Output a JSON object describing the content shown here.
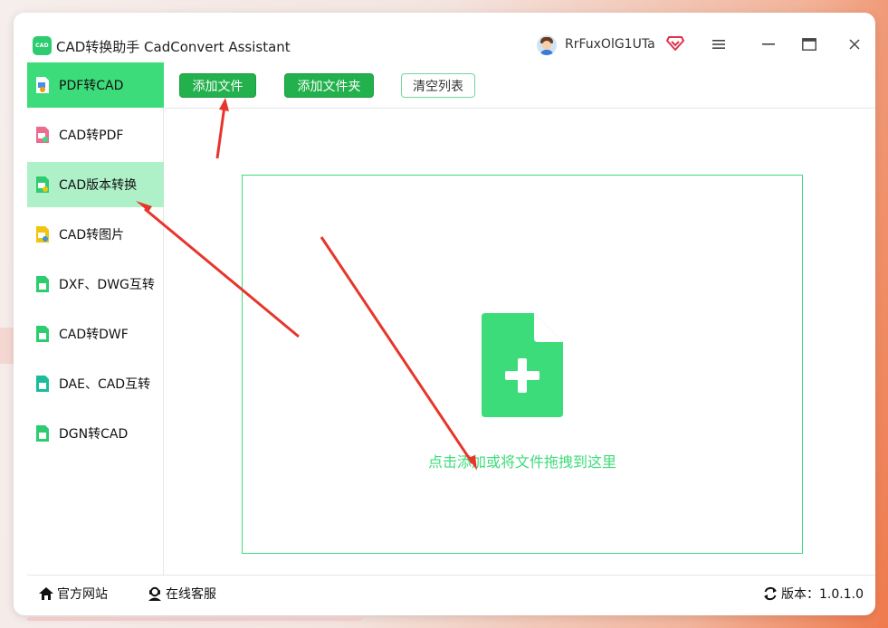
{
  "app": {
    "logo_text": "CAD",
    "title": "CAD转换助手 CadConvert Assistant",
    "user_name": "RrFuxOlG1UTa",
    "accent_color": "#3ddc7a",
    "window_controls": [
      "menu-icon",
      "minimize-icon",
      "maximize-icon",
      "close-icon"
    ]
  },
  "sidebar": {
    "items": [
      {
        "label": "PDF转CAD",
        "icon": "pdf-to-cad-icon",
        "state": "active"
      },
      {
        "label": "CAD转PDF",
        "icon": "cad-to-pdf-icon",
        "state": "normal"
      },
      {
        "label": "CAD版本转换",
        "icon": "cad-version-icon",
        "state": "hover"
      },
      {
        "label": "CAD转图片",
        "icon": "cad-to-image-icon",
        "state": "normal"
      },
      {
        "label": "DXF、DWG互转",
        "icon": "dxf-dwg-icon",
        "state": "normal"
      },
      {
        "label": "CAD转DWF",
        "icon": "cad-to-dwf-icon",
        "state": "normal"
      },
      {
        "label": "DAE、CAD互转",
        "icon": "dae-cad-icon",
        "state": "normal"
      },
      {
        "label": "DGN转CAD",
        "icon": "dgn-to-cad-icon",
        "state": "normal"
      }
    ]
  },
  "toolbar": {
    "add_file": "添加文件",
    "add_folder": "添加文件夹",
    "clear_list": "清空列表"
  },
  "dropzone": {
    "icon": "add-file-icon",
    "text": "点击添加或将文件拖拽到这里"
  },
  "footer": {
    "website": "官方网站",
    "service": "在线客服",
    "version": "版本：1.0.1.0"
  }
}
